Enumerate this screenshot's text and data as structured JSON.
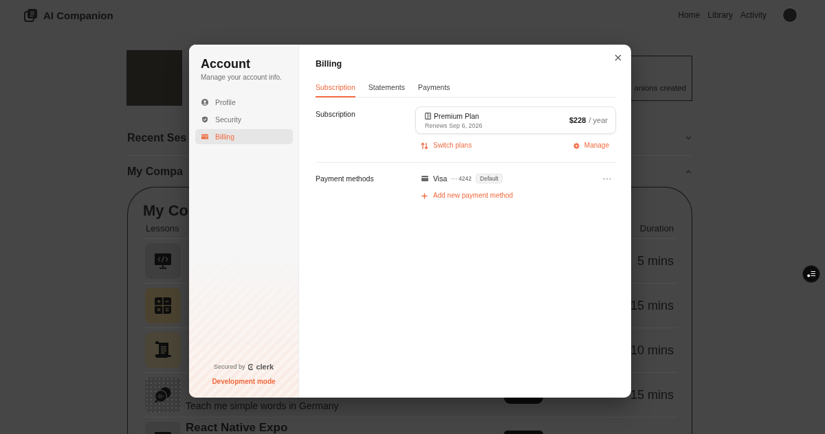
{
  "header": {
    "app_title": "AI Companion",
    "nav": [
      {
        "label": "Home"
      },
      {
        "label": "Library"
      },
      {
        "label": "Activity"
      }
    ]
  },
  "profile": {
    "stat_text": "anions created"
  },
  "sections": [
    {
      "title": "Recent Ses",
      "expanded": false
    },
    {
      "title": "My Compa",
      "expanded": true
    }
  ],
  "companions": {
    "title": "My Co",
    "columns": [
      "Lessons",
      "Duration"
    ],
    "rows": [
      {
        "kind": "coding",
        "badge": false,
        "duration": "5 mins"
      },
      {
        "kind": "maths",
        "badge": false,
        "duration": "15 mins"
      },
      {
        "kind": "history",
        "badge": false,
        "duration": "10 mins"
      },
      {
        "kind": "language",
        "subtitle": "Teach me simple words in Germany",
        "badge": true,
        "duration": "15 mins"
      },
      {
        "kind": "coding",
        "title": "React Native Expo",
        "badge": true
      }
    ]
  },
  "account_modal": {
    "title": "Account",
    "subtitle": "Manage your account info.",
    "nav": [
      {
        "kind": "profile",
        "label": "Profile",
        "selected": false
      },
      {
        "kind": "security",
        "label": "Security",
        "selected": false
      },
      {
        "kind": "billing",
        "label": "Billing",
        "selected": true
      }
    ],
    "secured_by": "Secured by",
    "brand": "clerk",
    "dev_mode": "Development mode",
    "page_title": "Billing",
    "tabs": [
      {
        "label": "Subscription",
        "selected": true
      },
      {
        "label": "Statements",
        "selected": false
      },
      {
        "label": "Payments",
        "selected": false
      }
    ],
    "subscription": {
      "label": "Subscription",
      "plan": "Premium Plan",
      "renews": "Renews Sep 6, 2026",
      "price": "$228",
      "period": "/ year",
      "actions": [
        {
          "kind": "switch",
          "label": "Switch plans"
        },
        {
          "kind": "manage",
          "label": "Manage"
        }
      ]
    },
    "payment_methods": {
      "label": "Payment methods",
      "methods": [
        {
          "brand": "Visa",
          "number": "··· 4242",
          "tag": "Default"
        }
      ],
      "add_label": "Add new payment method"
    }
  }
}
